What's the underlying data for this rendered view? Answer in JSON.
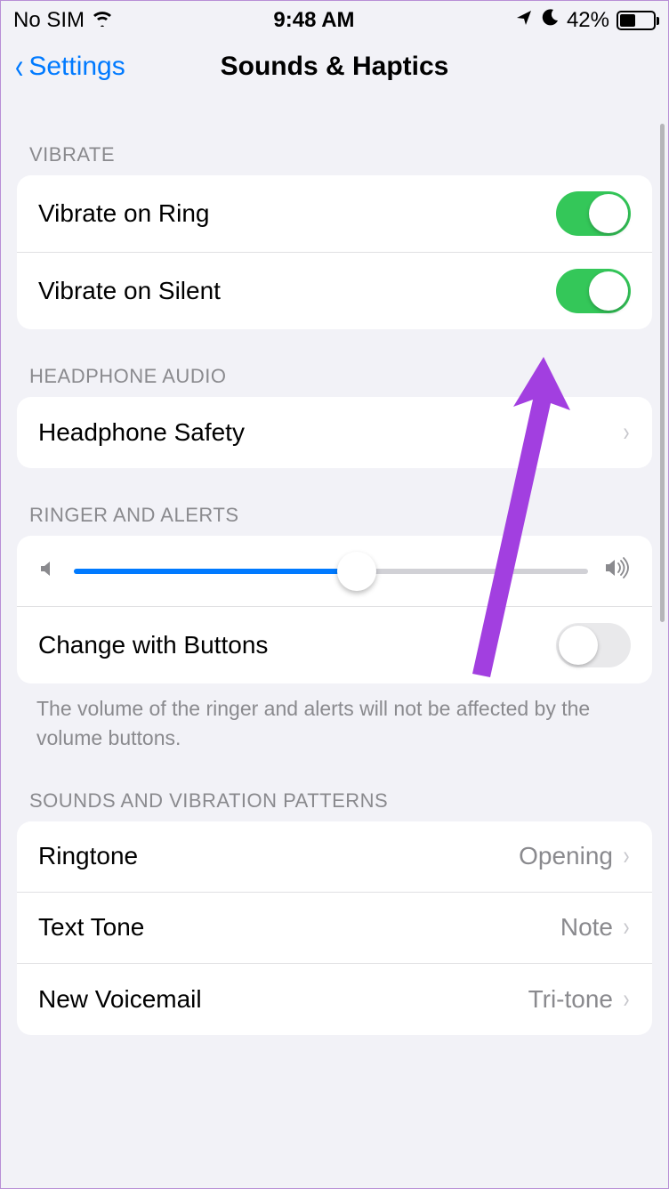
{
  "status": {
    "carrier": "No SIM",
    "time": "9:48 AM",
    "battery_pct": "42%",
    "battery_level": 42
  },
  "nav": {
    "back_label": "Settings",
    "title": "Sounds & Haptics"
  },
  "sections": {
    "vibrate": {
      "header": "VIBRATE",
      "rows": [
        {
          "label": "Vibrate on Ring",
          "on": true
        },
        {
          "label": "Vibrate on Silent",
          "on": true
        }
      ]
    },
    "headphone_audio": {
      "header": "HEADPHONE AUDIO",
      "rows": [
        {
          "label": "Headphone Safety"
        }
      ]
    },
    "ringer_alerts": {
      "header": "RINGER AND ALERTS",
      "slider_value": 55,
      "change_with_buttons": {
        "label": "Change with Buttons",
        "on": false
      },
      "footer": "The volume of the ringer and alerts will not be affected by the volume buttons."
    },
    "sounds_patterns": {
      "header": "SOUNDS AND VIBRATION PATTERNS",
      "rows": [
        {
          "label": "Ringtone",
          "value": "Opening"
        },
        {
          "label": "Text Tone",
          "value": "Note"
        },
        {
          "label": "New Voicemail",
          "value": "Tri-tone"
        }
      ]
    }
  }
}
